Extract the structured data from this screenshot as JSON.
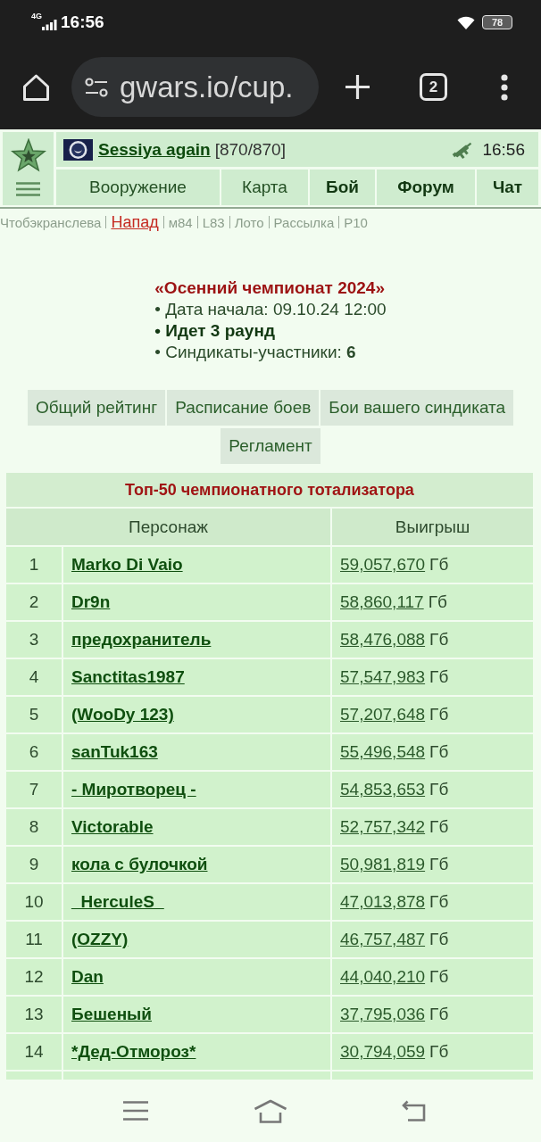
{
  "status_bar": {
    "network": "4G",
    "time": "16:56",
    "battery": "78"
  },
  "browser": {
    "url": "gwars.io/cup.",
    "tab_count": "2"
  },
  "header": {
    "player_name": "Sessiya again",
    "health": "[870/870]",
    "time": "16:56",
    "nav": [
      {
        "label": "Вооружение",
        "bold": false
      },
      {
        "label": "Карта",
        "bold": false
      },
      {
        "label": "Бой",
        "bold": true
      },
      {
        "label": "Форум",
        "bold": true
      },
      {
        "label": "Чат",
        "bold": true
      }
    ]
  },
  "quick_links": [
    {
      "label": "Чтобэкранслева",
      "kind": "plain"
    },
    {
      "label": "Напад",
      "kind": "alert"
    },
    {
      "label": "м84",
      "kind": "plain"
    },
    {
      "label": "L83",
      "kind": "plain"
    },
    {
      "label": "Лото",
      "kind": "plain"
    },
    {
      "label": "Рассылка",
      "kind": "plain"
    },
    {
      "label": "P10",
      "kind": "plain"
    }
  ],
  "championship": {
    "title": "«Осенний чемпионат 2024»",
    "facts": [
      {
        "text": "• Дата начала: 09.10.24 12:00",
        "bold": false
      },
      {
        "text": "• Идет 3 раунд",
        "bold": true
      },
      {
        "text": "• Синдикаты-участники: **6**",
        "bold": false
      }
    ]
  },
  "menu": [
    "Общий рейтинг",
    "Расписание боев",
    "Бои вашего синдиката",
    "Регламент"
  ],
  "table": {
    "title": "Топ-50 чемпионатного тотализатора",
    "columns": [
      "Персонаж",
      "Выигрыш"
    ],
    "rows": [
      {
        "rank": "1",
        "name": "Marko Di Vaio",
        "amount": "59,057,670",
        "unit": "Гб"
      },
      {
        "rank": "2",
        "name": "Dr9n",
        "amount": "58,860,117",
        "unit": "Гб"
      },
      {
        "rank": "3",
        "name": "предохранитель",
        "amount": "58,476,088",
        "unit": "Гб"
      },
      {
        "rank": "4",
        "name": "Sanctitas1987",
        "amount": "57,547,983",
        "unit": "Гб"
      },
      {
        "rank": "5",
        "name": "(WooDy 123)",
        "amount": "57,207,648",
        "unit": "Гб"
      },
      {
        "rank": "6",
        "name": "sanTuk163",
        "amount": "55,496,548",
        "unit": "Гб"
      },
      {
        "rank": "7",
        "name": "- Миротворец -",
        "amount": "54,853,653",
        "unit": "Гб"
      },
      {
        "rank": "8",
        "name": "Victorable",
        "amount": "52,757,342",
        "unit": "Гб"
      },
      {
        "rank": "9",
        "name": "кола с булочкой",
        "amount": "50,981,819",
        "unit": "Гб"
      },
      {
        "rank": "10",
        "name": "_HerculeS_",
        "amount": "47,013,878",
        "unit": "Гб"
      },
      {
        "rank": "11",
        "name": "(OZZY)",
        "amount": "46,757,487",
        "unit": "Гб"
      },
      {
        "rank": "12",
        "name": "Dan",
        "amount": "44,040,210",
        "unit": "Гб"
      },
      {
        "rank": "13",
        "name": "Бешеный",
        "amount": "37,795,036",
        "unit": "Гб"
      },
      {
        "rank": "14",
        "name": "*Дед-Отмороз*",
        "amount": "30,794,059",
        "unit": "Гб"
      }
    ]
  }
}
